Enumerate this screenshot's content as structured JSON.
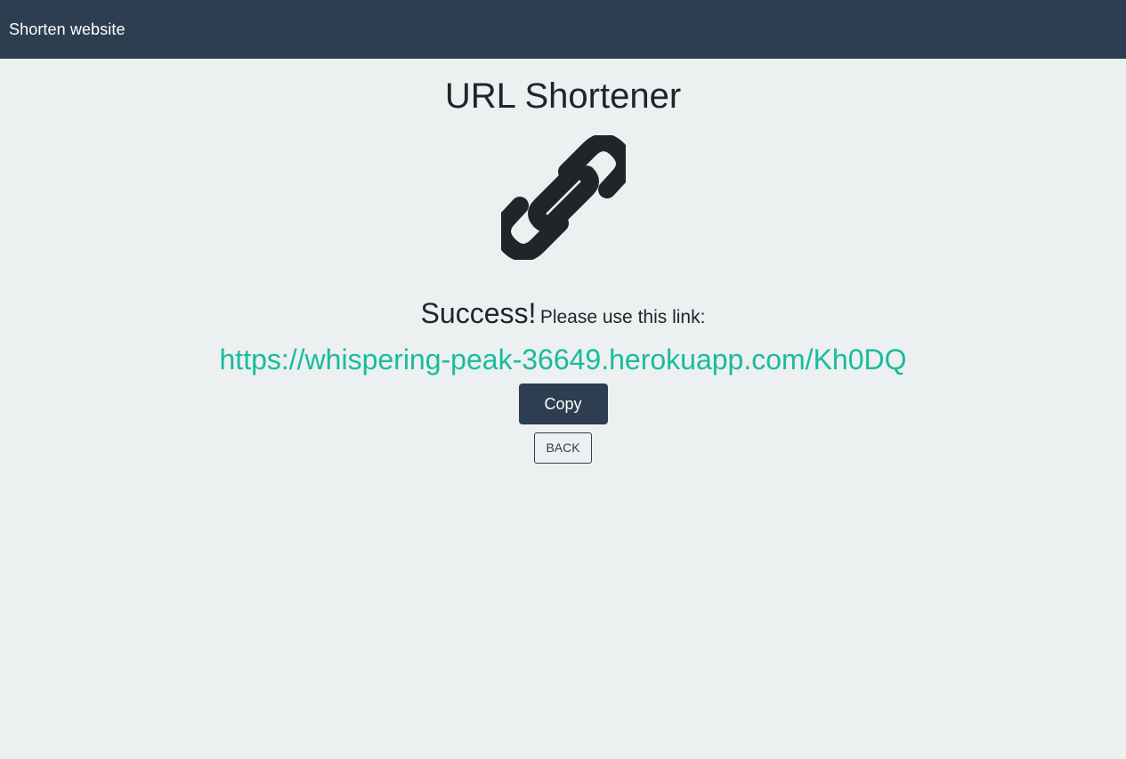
{
  "navbar": {
    "brand": "Shorten website"
  },
  "main": {
    "title": "URL Shortener",
    "icon": "link-icon",
    "success_word": "Success!",
    "success_message": "Please use this link:",
    "short_url": "https://whispering-peak-36649.herokuapp.com/Kh0DQ",
    "copy_label": "Copy",
    "back_label": "BACK"
  },
  "colors": {
    "navbar_bg": "#2c3e50",
    "page_bg": "#ecf0f1",
    "link": "#18bc9c",
    "primary_button": "#2c3e50"
  }
}
